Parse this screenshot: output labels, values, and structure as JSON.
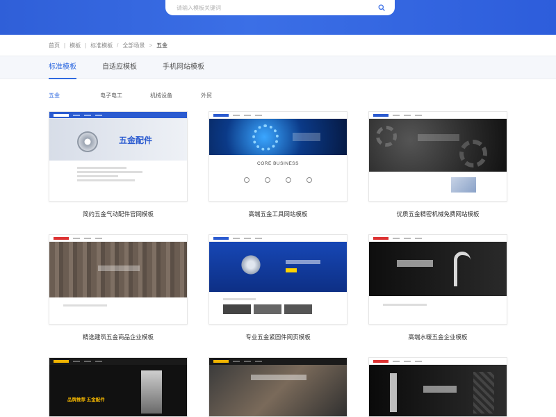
{
  "search": {
    "placeholder": "请输入模板关键词"
  },
  "breadcrumb": [
    "首页",
    "模板",
    "标准模板",
    "全部场景",
    "五金"
  ],
  "tabs": [
    {
      "label": "标准模板",
      "active": true
    },
    {
      "label": "自适应模板",
      "active": false
    },
    {
      "label": "手机网站模板",
      "active": false
    }
  ],
  "categories": [
    {
      "label": "五金",
      "active": true
    },
    {
      "label": "电子电工",
      "active": false
    },
    {
      "label": "机械设备",
      "active": false
    },
    {
      "label": "外贸",
      "active": false
    }
  ],
  "templates": [
    {
      "title": "简约五金气动配件官网模板",
      "banner_text": "五金配件"
    },
    {
      "title": "高端五金工具网站模板",
      "section_text": "CORE BUSINESS"
    },
    {
      "title": "优质五金精密机械免费网站模板"
    },
    {
      "title": "精选建筑五金商品企业模板"
    },
    {
      "title": "专业五金紧固件网页模板"
    },
    {
      "title": "高端水暖五金企业模板"
    },
    {
      "title": "",
      "banner_text": "品牌推荐 五金配件"
    },
    {
      "title": ""
    },
    {
      "title": ""
    }
  ],
  "colors": {
    "header_bg": "#2f5fd8",
    "accent": "#2f6ae0"
  }
}
